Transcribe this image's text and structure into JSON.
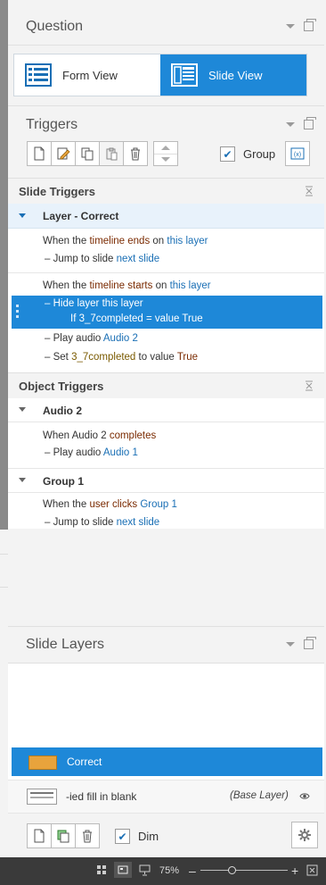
{
  "question": {
    "title": "Question",
    "form_view": "Form View",
    "slide_view": "Slide View"
  },
  "triggers": {
    "title": "Triggers",
    "group_label": "Group",
    "slide_section": "Slide Triggers",
    "layer_group": "Layer - Correct",
    "t1": {
      "when": "When the",
      "event": "timeline ends",
      "on": "on",
      "obj": "this layer"
    },
    "t1a": {
      "action": "Jump to slide",
      "target": "next slide"
    },
    "t2": {
      "when": "When the",
      "event": "timeline starts",
      "on": "on",
      "obj": "this layer"
    },
    "t2a": {
      "action": "Hide layer",
      "target": "this layer",
      "cond": "If 3_7completed = value True"
    },
    "t2b": {
      "action": "Play audio",
      "target": "Audio 2"
    },
    "t2c": {
      "action": "Set",
      "var": "3_7completed",
      "to": "to value",
      "value": "True"
    },
    "object_section": "Object Triggers",
    "audio_group": "Audio 2",
    "t3": {
      "when": "When",
      "obj": "Audio 2",
      "event": "completes"
    },
    "t3a": {
      "action": "Play audio",
      "target": "Audio 1"
    },
    "group1": "Group 1",
    "t4": {
      "when": "When the",
      "event": "user clicks",
      "obj": "Group 1"
    },
    "t4a": {
      "action": "Jump to slide",
      "target": "next slide"
    }
  },
  "layers": {
    "title": "Slide Layers",
    "correct": "Correct",
    "base_name": "-ied fill in blank",
    "base_tag": "(Base Layer)",
    "dim_label": "Dim"
  },
  "status": {
    "zoom": "75%"
  }
}
